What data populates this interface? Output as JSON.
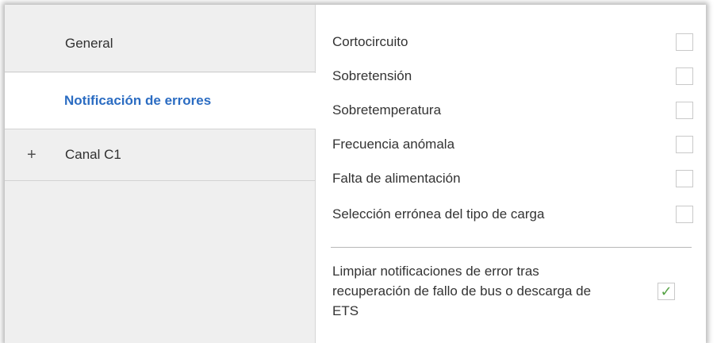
{
  "sidebar": {
    "items": [
      {
        "label": "General",
        "expand": ""
      },
      {
        "label": "Notificación de errores",
        "expand": ""
      },
      {
        "label": "Canal C1",
        "expand": "+"
      }
    ]
  },
  "main": {
    "options": [
      {
        "label": "Cortocircuito",
        "checked": false
      },
      {
        "label": "Sobretensión",
        "checked": false
      },
      {
        "label": "Sobretemperatura",
        "checked": false
      },
      {
        "label": "Frecuencia anómala",
        "checked": false
      },
      {
        "label": "Falta de alimentación",
        "checked": false
      },
      {
        "label": "Selección errónea del tipo de carga",
        "checked": false
      }
    ],
    "clear": {
      "line1": "Limpiar notificaciones de error tras",
      "line2": "recuperación de fallo de bus o descarga de",
      "line3": "ETS",
      "checked": true,
      "check_glyph": "✓"
    }
  },
  "colors": {
    "active_nav": "#2b6cc2",
    "sidebar_bg": "#efefef",
    "check": "#55a244"
  }
}
